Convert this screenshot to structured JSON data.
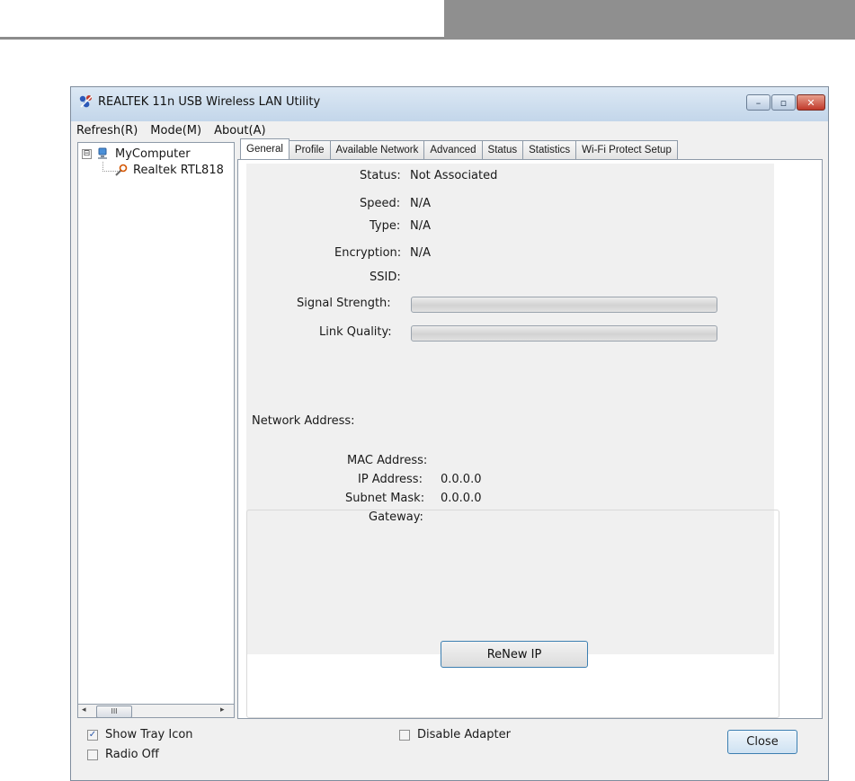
{
  "window": {
    "title": "REALTEK 11n USB Wireless LAN Utility",
    "controls": {
      "minimize": "–",
      "maximize": "▫",
      "close": "✕"
    }
  },
  "menu": [
    "Refresh(R)",
    "Mode(M)",
    "About(A)"
  ],
  "tree": {
    "root_label": "MyComputer",
    "root_expander": "⊟",
    "child_label": "Realtek RTL818"
  },
  "scrollbar": {
    "left_arrow": "◂",
    "thumb": "III",
    "right_arrow": "▸"
  },
  "tabs": [
    "General",
    "Profile",
    "Available Network",
    "Advanced",
    "Status",
    "Statistics",
    "Wi-Fi Protect Setup"
  ],
  "active_tab": "General",
  "general": {
    "status_label": "Status:",
    "status_value": "Not Associated",
    "speed_label": "Speed:",
    "speed_value": "N/A",
    "type_label": "Type:",
    "type_value": "N/A",
    "encryption_label": "Encryption:",
    "encryption_value": "N/A",
    "ssid_label": "SSID:",
    "ssid_value": "",
    "signal_label": "Signal Strength:",
    "signal_percent": 0,
    "link_label": "Link Quality:",
    "link_percent": 0
  },
  "network": {
    "heading": "Network Address:",
    "mac_label": "MAC Address:",
    "mac_value": "",
    "ip_label": "IP Address:",
    "ip_value": "0.0.0.0",
    "subnet_label": "Subnet Mask:",
    "subnet_value": "0.0.0.0",
    "gateway_label": "Gateway:",
    "gateway_value": ""
  },
  "renew_button": "ReNew IP",
  "bottom": {
    "show_tray_label": "Show Tray Icon",
    "show_tray_checked": true,
    "radio_off_label": "Radio Off",
    "radio_off_checked": false,
    "disable_adapter_label": "Disable Adapter",
    "disable_adapter_checked": false,
    "close_button": "Close"
  },
  "colors": {
    "title_gradient_top": "#dce8f4",
    "accent_border": "#3c7fb1",
    "window_bg": "#f0f0f0"
  }
}
